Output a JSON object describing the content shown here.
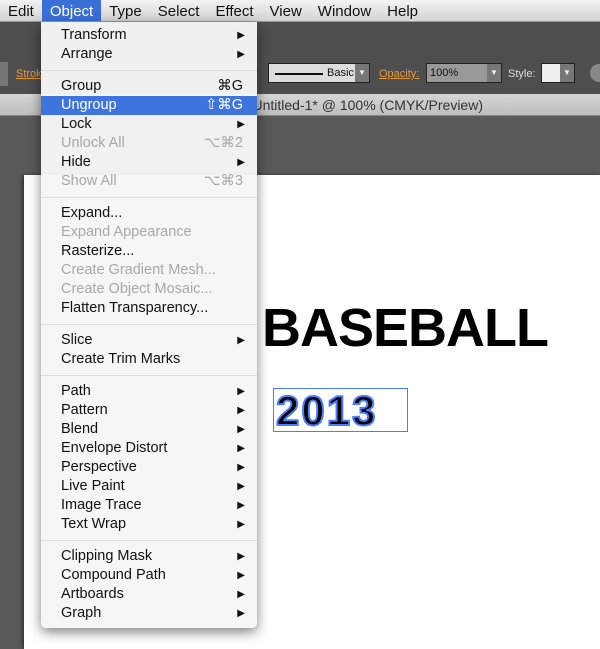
{
  "menubar": {
    "items": [
      "Edit",
      "Object",
      "Type",
      "Select",
      "Effect",
      "View",
      "Window",
      "Help"
    ],
    "active": "Object"
  },
  "control_bar": {
    "stroke_label": "Stroke",
    "brush": "Basic",
    "opacity_label": "Opacity:",
    "opacity_value": "100%",
    "style_label": "Style:"
  },
  "document": {
    "title": "Untitled-1* @ 100% (CMYK/Preview)"
  },
  "artboard": {
    "heading": "BASEBALL",
    "year": "2013",
    "selection_color": "#4a7cff"
  },
  "menu": {
    "groups": [
      [
        {
          "label": "Transform",
          "submenu": true
        },
        {
          "label": "Arrange",
          "submenu": true
        }
      ],
      [
        {
          "label": "Group",
          "shortcut": "⌘G"
        },
        {
          "label": "Ungroup",
          "shortcut": "⇧⌘G",
          "highlighted": true
        },
        {
          "label": "Lock",
          "submenu": true
        },
        {
          "label": "Unlock All",
          "shortcut": "⌥⌘2",
          "disabled": true
        },
        {
          "label": "Hide",
          "submenu": true
        },
        {
          "label": "Show All",
          "shortcut": "⌥⌘3",
          "disabled": true
        }
      ],
      [
        {
          "label": "Expand..."
        },
        {
          "label": "Expand Appearance",
          "disabled": true
        },
        {
          "label": "Rasterize..."
        },
        {
          "label": "Create Gradient Mesh...",
          "disabled": true
        },
        {
          "label": "Create Object Mosaic...",
          "disabled": true
        },
        {
          "label": "Flatten Transparency..."
        }
      ],
      [
        {
          "label": "Slice",
          "submenu": true
        },
        {
          "label": "Create Trim Marks"
        }
      ],
      [
        {
          "label": "Path",
          "submenu": true
        },
        {
          "label": "Pattern",
          "submenu": true
        },
        {
          "label": "Blend",
          "submenu": true
        },
        {
          "label": "Envelope Distort",
          "submenu": true
        },
        {
          "label": "Perspective",
          "submenu": true
        },
        {
          "label": "Live Paint",
          "submenu": true
        },
        {
          "label": "Image Trace",
          "submenu": true
        },
        {
          "label": "Text Wrap",
          "submenu": true
        }
      ],
      [
        {
          "label": "Clipping Mask",
          "submenu": true
        },
        {
          "label": "Compound Path",
          "submenu": true
        },
        {
          "label": "Artboards",
          "submenu": true
        },
        {
          "label": "Graph",
          "submenu": true
        }
      ]
    ]
  }
}
